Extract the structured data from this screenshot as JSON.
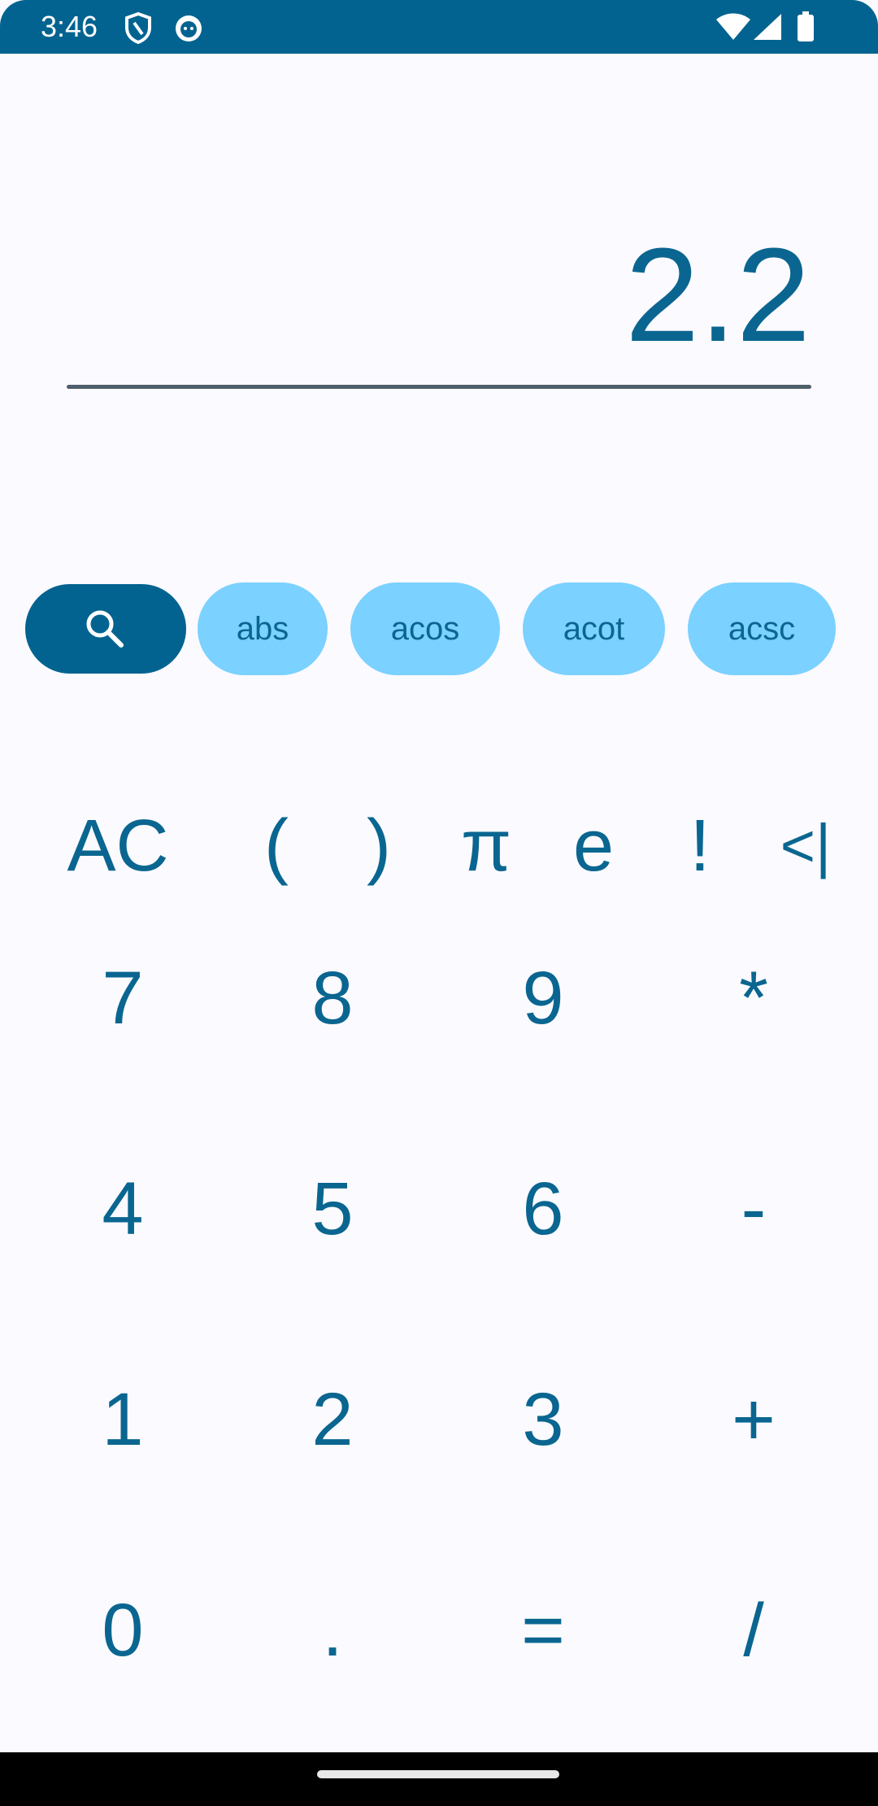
{
  "status_bar": {
    "time": "3:46",
    "icons": [
      "shield-icon",
      "cat-icon",
      "wifi-icon",
      "signal-icon",
      "battery-icon"
    ]
  },
  "display": {
    "value": "2.2"
  },
  "chips": {
    "search_icon": "search-icon",
    "items": [
      "abs",
      "acos",
      "acot",
      "acsc"
    ]
  },
  "functions": {
    "clear": "AC",
    "open_paren": "(",
    "close_paren": ")",
    "pi": "π",
    "e": "e",
    "factorial": "!",
    "backspace": "<|"
  },
  "keypad": {
    "rows": [
      [
        "7",
        "8",
        "9",
        "*"
      ],
      [
        "4",
        "5",
        "6",
        "-"
      ],
      [
        "1",
        "2",
        "3",
        "+"
      ],
      [
        "0",
        ".",
        "=",
        "/"
      ]
    ]
  },
  "colors": {
    "primary": "#036390",
    "text": "#0a6690",
    "chip": "#7bd1ff",
    "background": "#fbfaff"
  }
}
